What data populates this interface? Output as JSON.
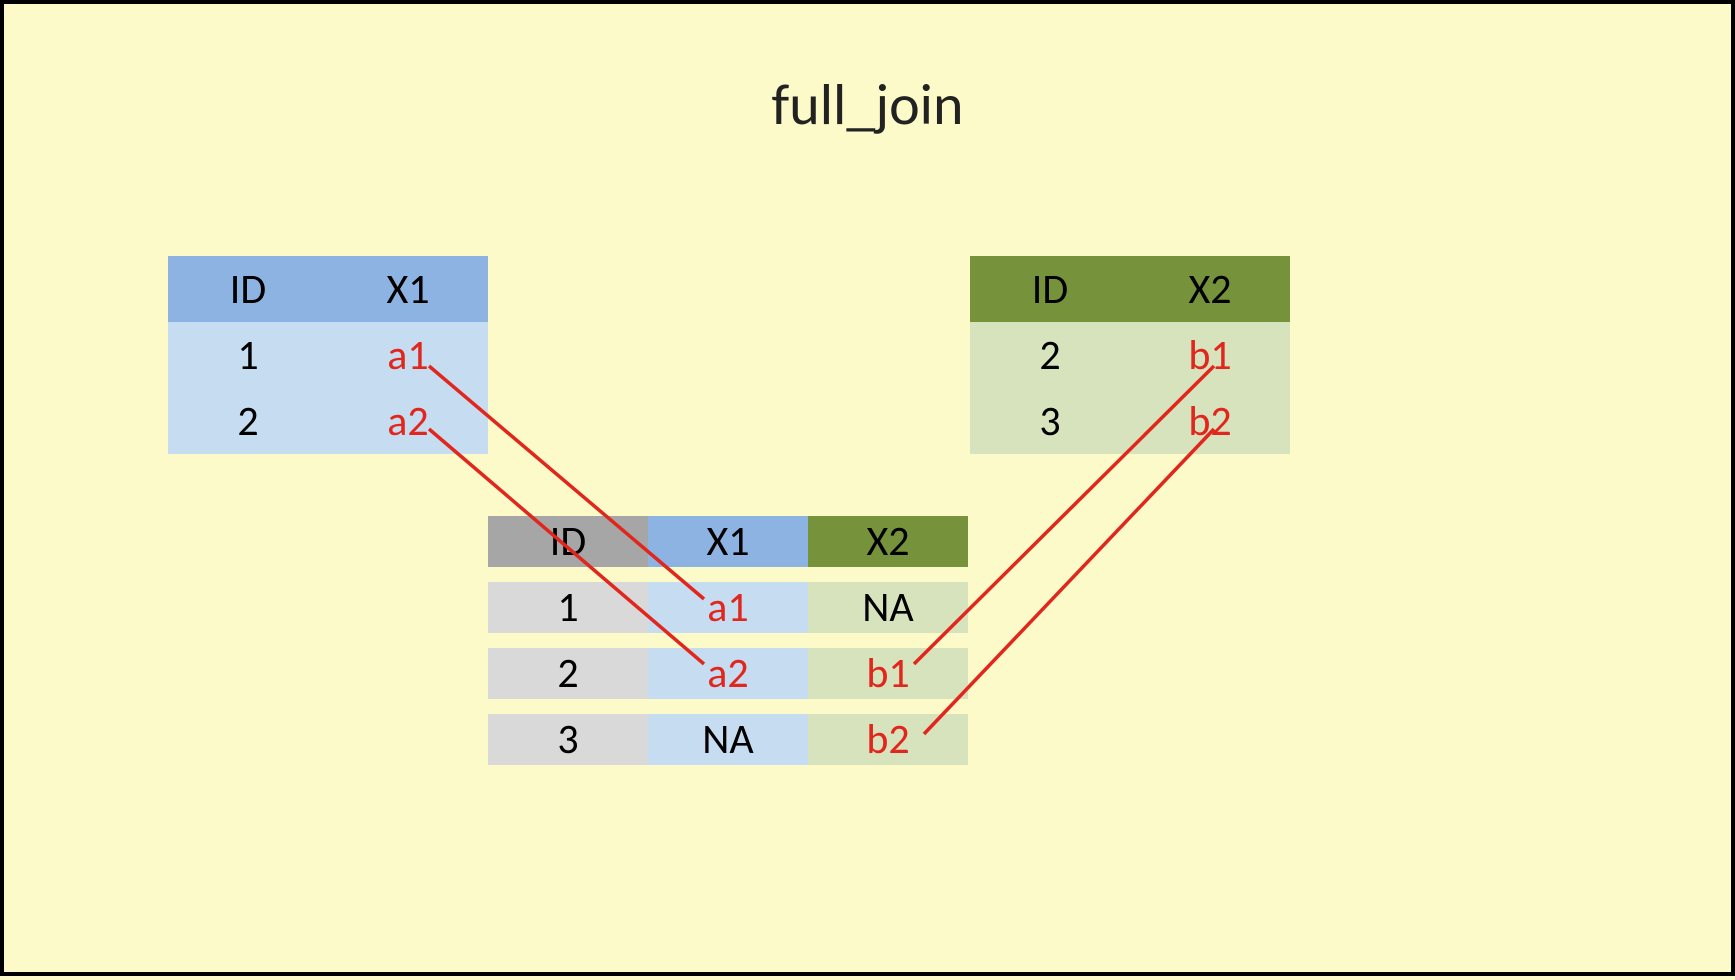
{
  "title": "full_join",
  "tableA": {
    "headers": [
      "ID",
      "X1"
    ],
    "rows": [
      {
        "id": "1",
        "x1": "a1"
      },
      {
        "id": "2",
        "x1": "a2"
      }
    ]
  },
  "tableB": {
    "headers": [
      "ID",
      "X2"
    ],
    "rows": [
      {
        "id": "2",
        "x2": "b1"
      },
      {
        "id": "3",
        "x2": "b2"
      }
    ]
  },
  "result": {
    "headers": [
      "ID",
      "X1",
      "X2"
    ],
    "rows": [
      {
        "id": "1",
        "x1": "a1",
        "x2": "NA"
      },
      {
        "id": "2",
        "x1": "a2",
        "x2": "b1"
      },
      {
        "id": "3",
        "x1": "NA",
        "x2": "b2"
      }
    ]
  },
  "colors": {
    "blue_header": "#8db3e2",
    "blue_body": "#c6dcf0",
    "green_header": "#76933c",
    "green_body": "#d7e3bc",
    "grey_header": "#a6a6a6",
    "grey_body": "#d9d9d9",
    "red": "#e0261d",
    "background": "#fcfac8"
  },
  "connectors": [
    {
      "from": "tableA.row0.x1",
      "to": "result.row0.x1"
    },
    {
      "from": "tableA.row1.x1",
      "to": "result.row1.x1"
    },
    {
      "from": "tableB.row0.x2",
      "to": "result.row1.x2"
    },
    {
      "from": "tableB.row1.x2",
      "to": "result.row2.x2"
    }
  ]
}
